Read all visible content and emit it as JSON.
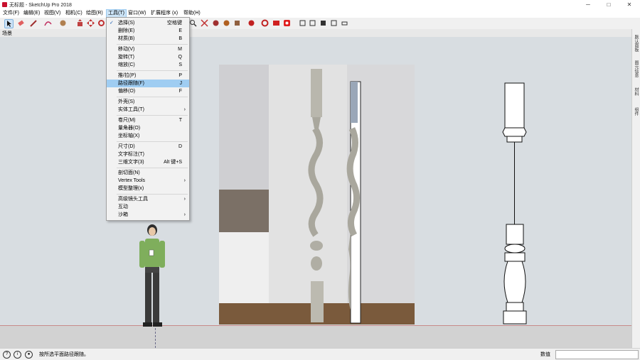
{
  "window": {
    "title": "无标题 - SketchUp Pro 2018",
    "minimize": "─",
    "maximize": "□",
    "close": "✕"
  },
  "menubar": [
    {
      "label": "文件(F)"
    },
    {
      "label": "编辑(E)"
    },
    {
      "label": "视图(V)"
    },
    {
      "label": "相机(C)"
    },
    {
      "label": "绘图(R)"
    },
    {
      "label": "工具(T)"
    },
    {
      "label": "窗口(W)"
    },
    {
      "label": "扩展程序 (x)"
    },
    {
      "label": "帮助(H)"
    }
  ],
  "scene_tab": "场景",
  "tools_menu": {
    "items": [
      {
        "label": "选择(S)",
        "shortcut": "空格键",
        "checked": true
      },
      {
        "label": "删除(E)",
        "shortcut": "E"
      },
      {
        "label": "材质(B)",
        "shortcut": "B"
      },
      {
        "sep": true
      },
      {
        "label": "移动(V)",
        "shortcut": "M"
      },
      {
        "label": "旋转(T)",
        "shortcut": "Q"
      },
      {
        "label": "缩放(C)",
        "shortcut": "S"
      },
      {
        "sep": true
      },
      {
        "label": "推/拉(P)",
        "shortcut": "P"
      },
      {
        "label": "路径跟随(F)",
        "shortcut": "J",
        "highlighted": true
      },
      {
        "label": "偏移(O)",
        "shortcut": "F"
      },
      {
        "sep": true
      },
      {
        "label": "外壳(S)",
        "shortcut": ""
      },
      {
        "label": "实体工具(T)",
        "shortcut": "",
        "submenu": true
      },
      {
        "sep": true
      },
      {
        "label": "卷尺(M)",
        "shortcut": "T"
      },
      {
        "label": "量角器(O)",
        "shortcut": ""
      },
      {
        "label": "坐标轴(X)",
        "shortcut": ""
      },
      {
        "sep": true
      },
      {
        "label": "尺寸(D)",
        "shortcut": "D"
      },
      {
        "label": "文字标注(T)",
        "shortcut": ""
      },
      {
        "label": "三维文字(3)",
        "shortcut": "Alt 键+S"
      },
      {
        "sep": true
      },
      {
        "label": "剖切面(N)",
        "shortcut": ""
      },
      {
        "label": "Vertex Tools",
        "shortcut": "",
        "submenu": true
      },
      {
        "label": "模型整理(x)",
        "shortcut": ""
      },
      {
        "sep": true
      },
      {
        "label": "高级镜头工具",
        "shortcut": "",
        "submenu": true
      },
      {
        "label": "互动",
        "shortcut": ""
      },
      {
        "label": "沙箱",
        "shortcut": "",
        "submenu": true
      }
    ]
  },
  "right_panel_tabs": [
    "默认面板",
    "图元信息",
    "材料",
    "组件"
  ],
  "status": {
    "text": "按所选平面路径跟随。",
    "measure_label": "数值",
    "measure_value": ""
  },
  "colors": {
    "viewport": "#d8dde1",
    "ground": "#d2d2d2",
    "highlight": "#9fcdf2",
    "horizon": "#c88a8a"
  }
}
